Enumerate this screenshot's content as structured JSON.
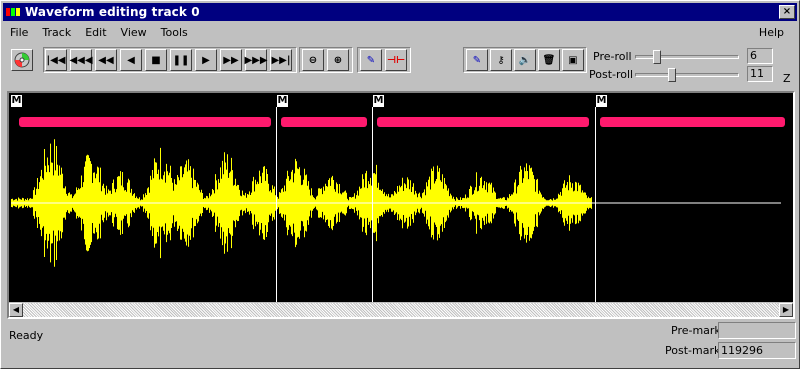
{
  "window": {
    "title": "Waveform editing track 0",
    "app_icon": "tri-color-app-icon",
    "close_glyph": "×"
  },
  "menu": {
    "items": [
      "File",
      "Track",
      "Edit",
      "View",
      "Tools"
    ],
    "help": "Help"
  },
  "toolbar": {
    "transport_buttons": [
      {
        "name": "go-to-start-icon",
        "glyph": "|◀◀"
      },
      {
        "name": "fast-rewind-icon",
        "glyph": "◀◀◀"
      },
      {
        "name": "rewind-icon",
        "glyph": "◀◀"
      },
      {
        "name": "step-back-icon",
        "glyph": "◀"
      },
      {
        "name": "stop-icon",
        "glyph": "■"
      },
      {
        "name": "pause-icon",
        "glyph": "❚❚"
      },
      {
        "name": "play-icon",
        "glyph": "▶"
      },
      {
        "name": "fast-forward-icon",
        "glyph": "▶▶"
      },
      {
        "name": "faster-forward-icon",
        "glyph": "▶▶▶"
      },
      {
        "name": "go-to-end-icon",
        "glyph": "▶▶|"
      }
    ],
    "zoom_out_glyph": "⊖",
    "zoom_in_glyph": "⊕",
    "pen_glyph": "✎",
    "split_glyph": "⊣⊢",
    "key_glyph": "⚷",
    "speaker_glyph": "🔊",
    "trash_glyph": "🗑",
    "doc_glyph": "▣"
  },
  "roll": {
    "preroll_label": "Pre-roll",
    "preroll_value": "6",
    "preroll_fraction": 0.18,
    "postroll_label": "Post-roll",
    "postroll_value": "11",
    "postroll_fraction": 0.33,
    "zoom_indicator": "Z"
  },
  "waveform": {
    "marker_flag": "M",
    "marker_count": 4,
    "waveform_color": "#ffff00",
    "region_color": "#ff1a6e",
    "background": "#000000"
  },
  "status": {
    "text": "Ready",
    "premark_label": "Pre-mark",
    "premark_value": "",
    "postmark_label": "Post-mark",
    "postmark_value": "119296"
  }
}
